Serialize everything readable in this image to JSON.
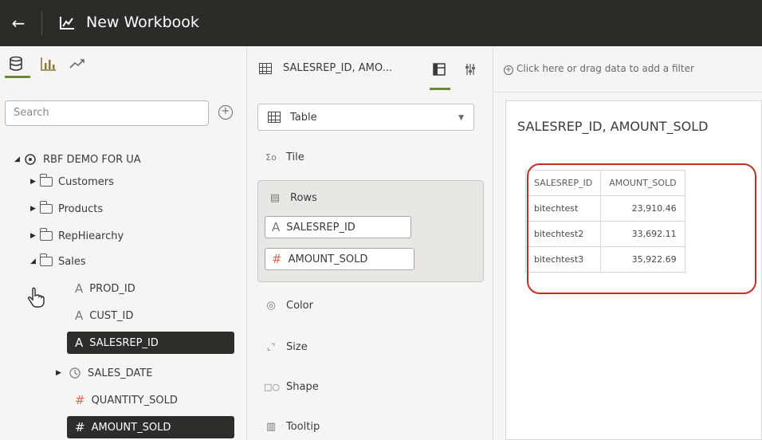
{
  "app": {
    "title": "New Workbook"
  },
  "data_panel": {
    "search_placeholder": "Search",
    "tree": {
      "root": "RBF DEMO FOR UA",
      "folders": [
        "Customers",
        "Products",
        "RepHiearchy",
        "Sales"
      ],
      "sales_columns": [
        {
          "name": "PROD_ID",
          "type": "A",
          "selected": false
        },
        {
          "name": "CUST_ID",
          "type": "A",
          "selected": false
        },
        {
          "name": "SALESREP_ID",
          "type": "A",
          "selected": true
        },
        {
          "name": "SALES_DATE",
          "type": "date",
          "selected": false
        },
        {
          "name": "QUANTITY_SOLD",
          "type": "#",
          "selected": false
        },
        {
          "name": "AMOUNT_SOLD",
          "type": "#",
          "selected": true
        }
      ]
    }
  },
  "grammar_panel": {
    "visualization_name": "SALESREP_ID, AMO...",
    "viz_type": "Table",
    "items": {
      "tile": "Tile",
      "rows": "Rows",
      "color": "Color",
      "size": "Size",
      "shape": "Shape",
      "tooltip": "Tooltip"
    },
    "rows_pills": [
      {
        "type": "A",
        "name": "SALESREP_ID"
      },
      {
        "type": "#",
        "name": "AMOUNT_SOLD"
      }
    ]
  },
  "canvas": {
    "filter_hint": "Click here or drag data to add a filter",
    "viz_title": "SALESREP_ID, AMOUNT_SOLD",
    "table": {
      "headers": [
        "SALESREP_ID",
        "AMOUNT_SOLD"
      ],
      "rows": [
        [
          "bitechtest",
          "23,910.46"
        ],
        [
          "bitechtest2",
          "33,692.11"
        ],
        [
          "bitechtest3",
          "35,922.69"
        ]
      ]
    }
  },
  "colors": {
    "accent_green": "#6a8a3b",
    "highlight_red": "#c42f25",
    "title_bar": "#2c2b28"
  }
}
